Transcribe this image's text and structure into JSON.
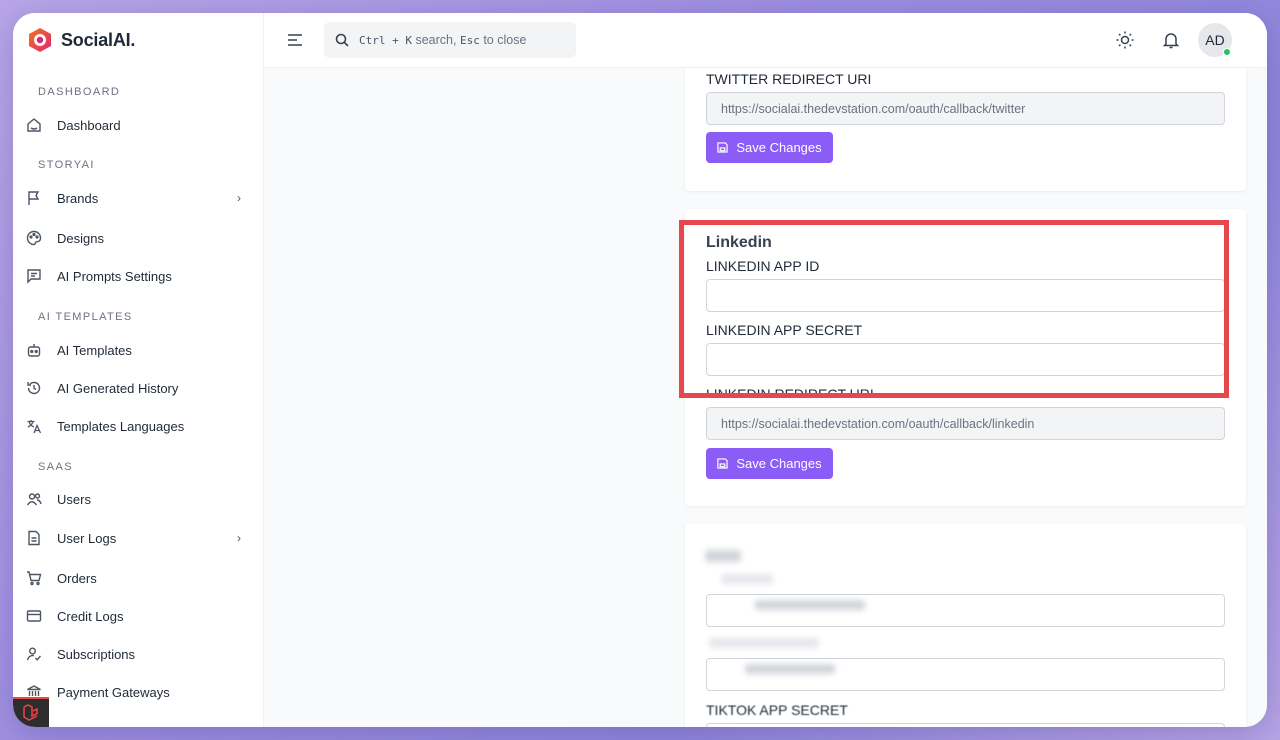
{
  "brand": {
    "name": "SocialAI."
  },
  "sidebar": {
    "sections": [
      {
        "label": "DASHBOARD"
      },
      {
        "label": "STORYAI"
      },
      {
        "label": "AI TEMPLATES"
      },
      {
        "label": "SAAS"
      }
    ],
    "items": [
      {
        "label": "Dashboard",
        "icon": "home-icon"
      },
      {
        "label": "Brands",
        "icon": "flag-icon",
        "has_children": true
      },
      {
        "label": "Designs",
        "icon": "palette-icon"
      },
      {
        "label": "AI Prompts Settings",
        "icon": "message-icon"
      },
      {
        "label": "AI Templates",
        "icon": "robot-icon"
      },
      {
        "label": "AI Generated History",
        "icon": "history-icon"
      },
      {
        "label": "Templates Languages",
        "icon": "translate-icon"
      },
      {
        "label": "Users",
        "icon": "users-icon"
      },
      {
        "label": "User Logs",
        "icon": "file-icon",
        "has_children": true
      },
      {
        "label": "Orders",
        "icon": "cart-icon"
      },
      {
        "label": "Credit Logs",
        "icon": "credit-card-icon"
      },
      {
        "label": "Subscriptions",
        "icon": "user-check-icon"
      },
      {
        "label": "Payment Gateways",
        "icon": "bank-icon"
      }
    ]
  },
  "header": {
    "search": {
      "key1": "Ctrl + K",
      "text1": "search,",
      "key2": "Esc",
      "text2": "to close"
    },
    "avatar_initials": "AD",
    "status_color": "#22c55e"
  },
  "twitter_card": {
    "redirect_label": "TWITTER REDIRECT URI",
    "redirect_value": "https://socialai.thedevstation.com/oauth/callback/twitter",
    "save_label": "Save Changes"
  },
  "linkedin_card": {
    "title": "Linkedin",
    "app_id_label": "LINKEDIN APP ID",
    "app_id_value": "",
    "app_secret_label": "LINKEDIN APP SECRET",
    "app_secret_value": "",
    "redirect_label": "LINKEDIN REDIRECT URI",
    "redirect_value": "https://socialai.thedevstation.com/oauth/callback/linkedin",
    "save_label": "Save Changes"
  },
  "tiktok_card": {
    "secret_label": "TIKTOK APP SECRET"
  },
  "colors": {
    "accent": "#8b5cf6",
    "highlight": "#e5484d"
  }
}
